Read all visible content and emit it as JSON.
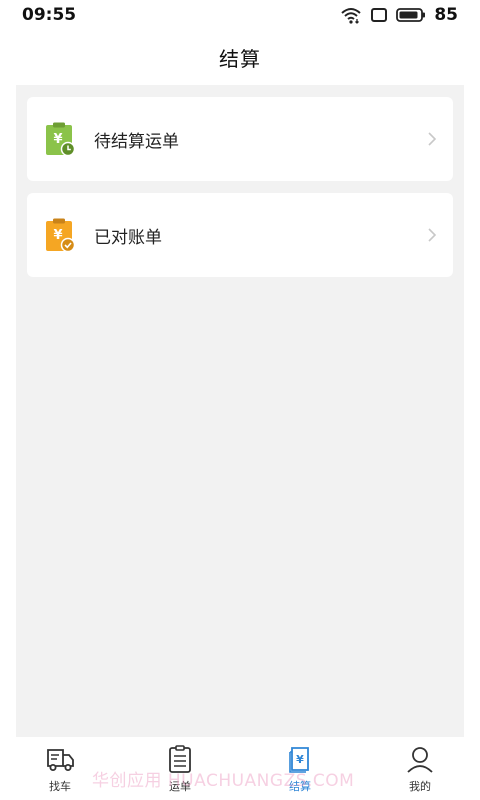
{
  "status_bar": {
    "time": "09:55",
    "battery": "85",
    "icons": [
      "wifi-icon",
      "screen-icon",
      "battery-icon"
    ]
  },
  "header": {
    "title": "结算"
  },
  "menu": {
    "items": [
      {
        "label": "待结算运单",
        "icon": "pending-settlement-icon",
        "icon_color": "#8bc34a"
      },
      {
        "label": "已对账单",
        "icon": "reconciled-bill-icon",
        "icon_color": "#f5a623"
      }
    ]
  },
  "tabbar": {
    "active_color": "#2f86d6",
    "tabs": [
      {
        "label": "找车",
        "icon": "truck-icon",
        "active": false
      },
      {
        "label": "运单",
        "icon": "waybill-icon",
        "active": false
      },
      {
        "label": "结算",
        "icon": "settlement-icon",
        "active": true
      },
      {
        "label": "我的",
        "icon": "profile-icon",
        "active": false
      }
    ]
  },
  "watermark": "华创应用 HUACHUANGZS.COM"
}
